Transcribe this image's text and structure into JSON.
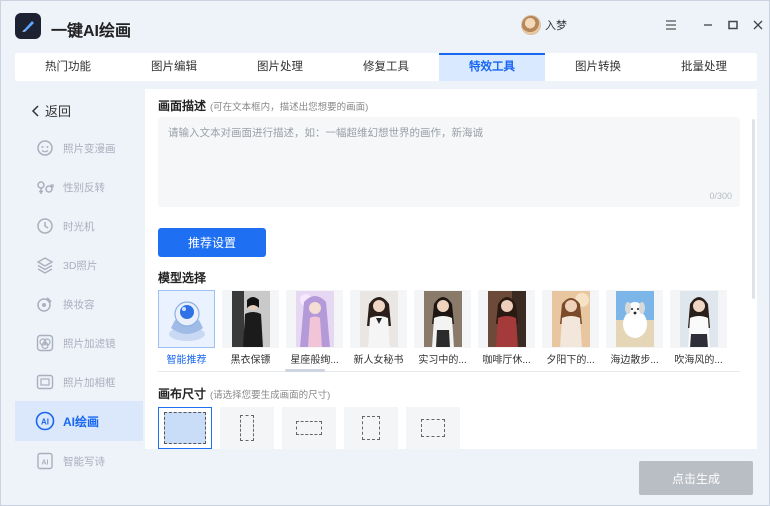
{
  "app": {
    "title": "一键AI绘画",
    "username": "入梦"
  },
  "tabs": [
    {
      "label": "热门功能"
    },
    {
      "label": "图片编辑"
    },
    {
      "label": "图片处理"
    },
    {
      "label": "修复工具"
    },
    {
      "label": "特效工具",
      "active": true
    },
    {
      "label": "图片转换"
    },
    {
      "label": "批量处理"
    }
  ],
  "sidebar": {
    "back_label": "返回",
    "items": [
      {
        "label": "照片变漫画",
        "icon": "comic-face-icon"
      },
      {
        "label": "性别反转",
        "icon": "gender-swap-icon"
      },
      {
        "label": "时光机",
        "icon": "time-machine-icon"
      },
      {
        "label": "3D照片",
        "icon": "layers-3d-icon"
      },
      {
        "label": "换妆容",
        "icon": "makeup-icon"
      },
      {
        "label": "照片加滤镜",
        "icon": "filter-icon"
      },
      {
        "label": "照片加相框",
        "icon": "photo-frame-icon"
      },
      {
        "label": "AI绘画",
        "icon": "ai-paint-icon",
        "active": true
      },
      {
        "label": "智能写诗",
        "icon": "ai-poem-icon"
      }
    ]
  },
  "main": {
    "description_title": "画面描述",
    "description_hint": "(可在文本框内，描述出您想要的画面)",
    "description_placeholder": "请输入文本对画面进行描述，如：一幅超维幻想世界的画作，新海诚",
    "counter": "0/300",
    "recommend_button": "推荐设置",
    "model_title": "模型选择",
    "models": [
      {
        "label": "智能推荐",
        "selected": true
      },
      {
        "label": "黑衣保镖"
      },
      {
        "label": "星座般绚..."
      },
      {
        "label": "新人女秘书"
      },
      {
        "label": "实习中的..."
      },
      {
        "label": "咖啡厅休..."
      },
      {
        "label": "夕阳下的..."
      },
      {
        "label": "海边散步..."
      },
      {
        "label": "吹海风的..."
      }
    ],
    "canvas_title": "画布尺寸",
    "canvas_hint": "(请选择您要生成画面的尺寸)"
  },
  "footer": {
    "generate_button": "点击生成"
  }
}
